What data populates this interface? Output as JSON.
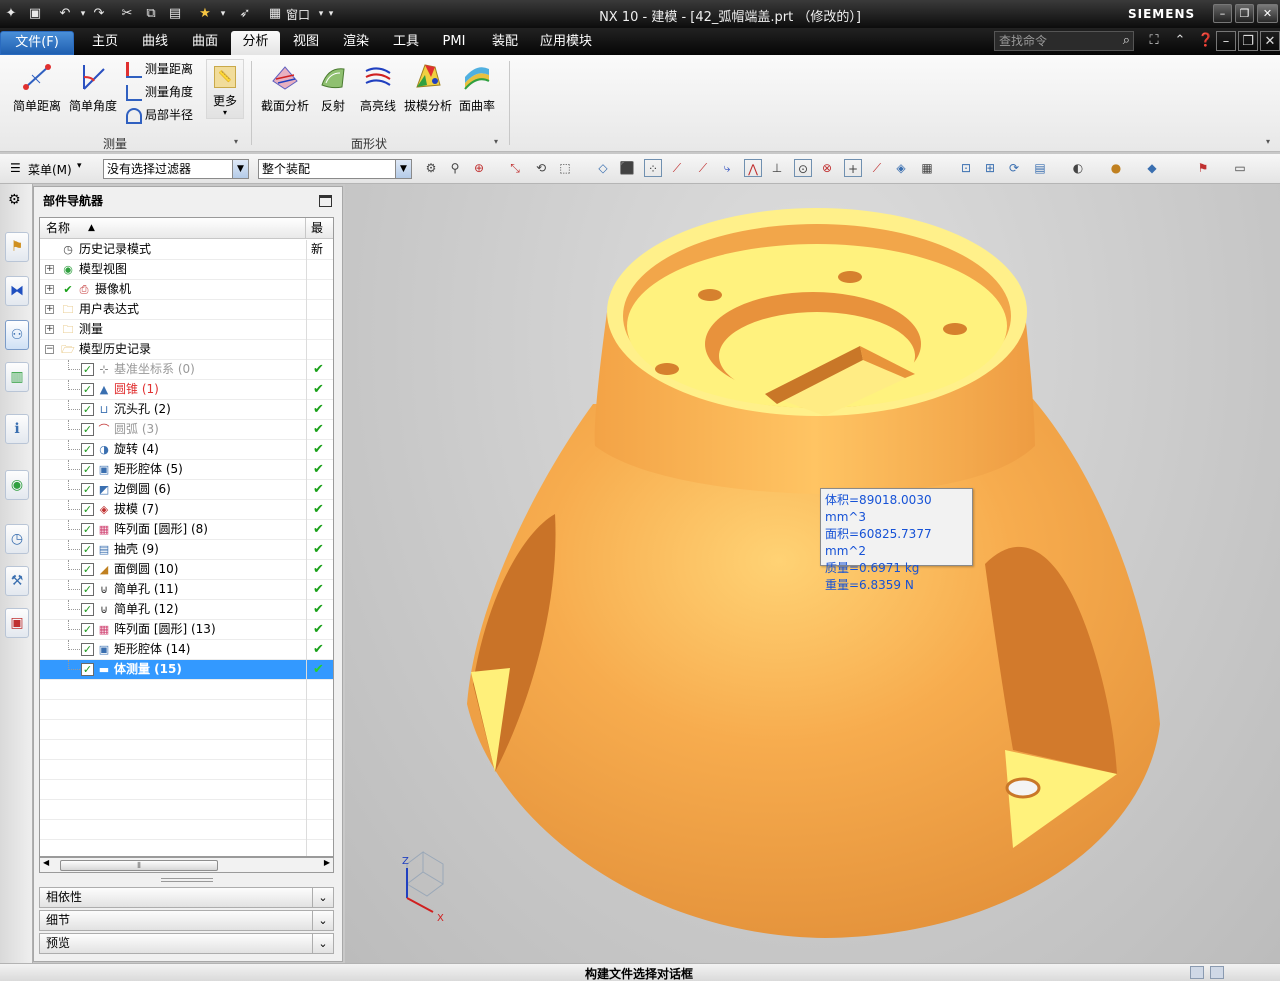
{
  "window": {
    "title": "NX 10 - 建模 - [42_弧帽端盖.prt （修改的）]",
    "brand": "SIEMENS",
    "window_menu": "窗口",
    "controls": [
      "minimize",
      "restore",
      "close"
    ]
  },
  "menubar": {
    "tabs": [
      "文件(F)",
      "主页",
      "曲线",
      "曲面",
      "分析",
      "视图",
      "渲染",
      "工具",
      "PMI",
      "装配",
      "应用模块"
    ],
    "active_tab": "分析",
    "search_placeholder": "查找命令"
  },
  "ribbon": {
    "measure_group": {
      "label": "测量",
      "big_buttons": [
        "简单距离",
        "简单角度"
      ],
      "small_buttons": [
        "测量距离",
        "测量角度",
        "局部半径"
      ],
      "more": "更多"
    },
    "shape_group": {
      "label": "面形状",
      "big_buttons": [
        "截面分析",
        "反射",
        "高亮线",
        "拔模分析",
        "面曲率"
      ]
    }
  },
  "toolbar": {
    "menu_label": "菜单(M)",
    "filter": "没有选择过滤器",
    "scope": "整个装配"
  },
  "navigator": {
    "title": "部件导航器",
    "col_name": "名称",
    "col_latest": "最新",
    "nodes": [
      {
        "label": "历史记录模式",
        "level": 0,
        "icon": "clock"
      },
      {
        "label": "模型视图",
        "level": 0,
        "icon": "views",
        "expand": "+"
      },
      {
        "label": "摄像机",
        "level": 0,
        "icon": "camera",
        "expand": "+"
      },
      {
        "label": "用户表达式",
        "level": 0,
        "icon": "folder",
        "expand": "+"
      },
      {
        "label": "测量",
        "level": 0,
        "icon": "folder",
        "expand": "+"
      },
      {
        "label": "模型历史记录",
        "level": 0,
        "icon": "folder-open",
        "expand": "−"
      }
    ],
    "features": [
      {
        "label": "基准坐标系 (0)",
        "style": "gray",
        "icon": "datum-csys"
      },
      {
        "label": "圆锥 (1)",
        "style": "red",
        "icon": "cone"
      },
      {
        "label": "沉头孔 (2)",
        "style": "normal",
        "icon": "counterbore-hole"
      },
      {
        "label": "圆弧 (3)",
        "style": "gray",
        "icon": "arc"
      },
      {
        "label": "旋转 (4)",
        "style": "normal",
        "icon": "revolve"
      },
      {
        "label": "矩形腔体 (5)",
        "style": "normal",
        "icon": "pocket"
      },
      {
        "label": "边倒圆 (6)",
        "style": "normal",
        "icon": "edge-blend"
      },
      {
        "label": "拔模 (7)",
        "style": "normal",
        "icon": "draft"
      },
      {
        "label": "阵列面 [圆形] (8)",
        "style": "normal",
        "icon": "pattern-face"
      },
      {
        "label": "抽壳 (9)",
        "style": "normal",
        "icon": "shell"
      },
      {
        "label": "面倒圆 (10)",
        "style": "normal",
        "icon": "face-blend"
      },
      {
        "label": "简单孔 (11)",
        "style": "normal",
        "icon": "hole"
      },
      {
        "label": "简单孔 (12)",
        "style": "normal",
        "icon": "hole"
      },
      {
        "label": "阵列面 [圆形] (13)",
        "style": "normal",
        "icon": "pattern-face"
      },
      {
        "label": "矩形腔体 (14)",
        "style": "normal",
        "icon": "pocket"
      },
      {
        "label": "体测量 (15)",
        "style": "selected",
        "icon": "body-measure"
      }
    ],
    "accordions": [
      "相依性",
      "细节",
      "预览"
    ]
  },
  "measurement_tooltip": {
    "volume": "体积=89018.0030 mm^3",
    "area": "面积=60825.7377 mm^2",
    "mass": "质量=0.6971 kg",
    "weight": "重量=6.8359 N"
  },
  "triad": {
    "z": "Z",
    "x": "X"
  },
  "status": {
    "message": "构建文件选择对话框"
  },
  "colors": {
    "part_body": "#f5a748",
    "part_highlight": "#fff48a",
    "selection": "#3399ff",
    "tooltip_text": "#1652d6",
    "check_green": "#18a018"
  }
}
